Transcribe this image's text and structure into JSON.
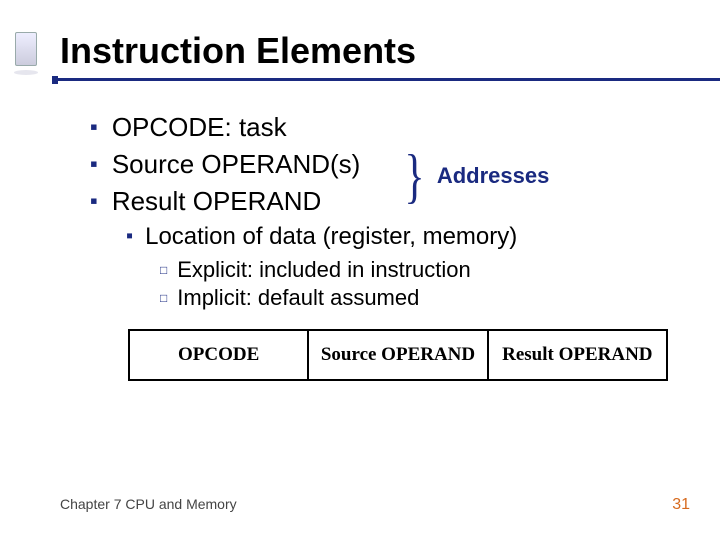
{
  "title": "Instruction Elements",
  "bullets": {
    "b1": "OPCODE: task",
    "b2": "Source OPERAND(s)",
    "b3": "Result OPERAND"
  },
  "brace_label": "Addresses",
  "sub": {
    "s1": "Location of data (register, memory)"
  },
  "subsub": {
    "ss1": "Explicit: included in instruction",
    "ss2": "Implicit: default assumed"
  },
  "boxes": {
    "c1": "OPCODE",
    "c2": "Source OPERAND",
    "c3": "Result OPERAND"
  },
  "footer": {
    "chapter": "Chapter 7 CPU and Memory",
    "page": "31"
  }
}
